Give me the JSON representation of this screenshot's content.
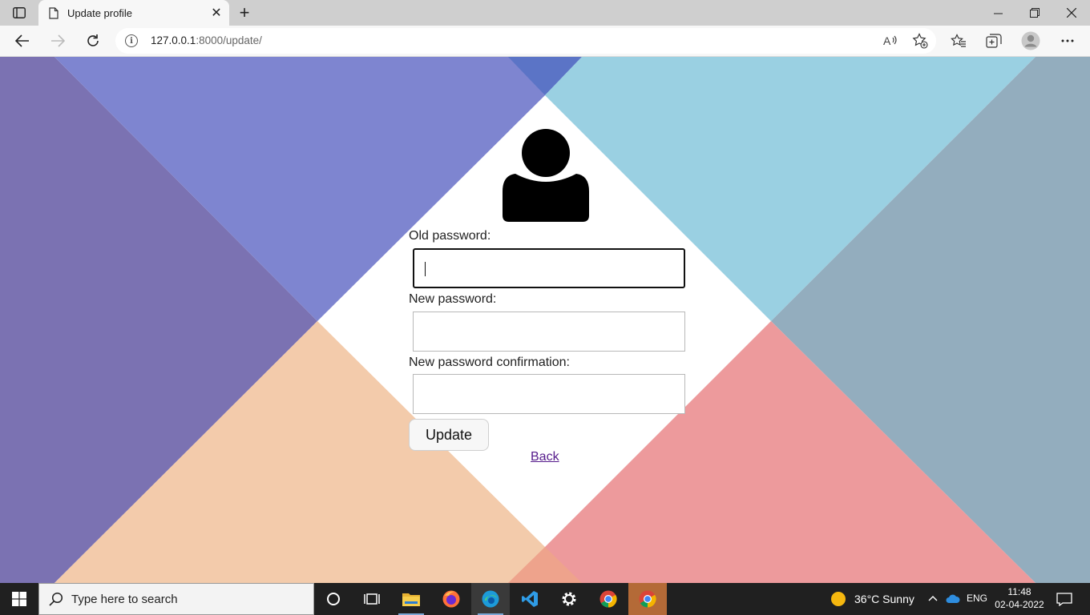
{
  "browser": {
    "tab_title": "Update profile",
    "url_host": "127.0.0.1",
    "url_rest": ":8000/update/"
  },
  "form": {
    "old_password_label": "Old password:",
    "new_password_label": "New password:",
    "confirm_password_label": "New password confirmation:",
    "old_password_value": "",
    "new_password_value": "",
    "confirm_password_value": "",
    "update_button": "Update",
    "back_link": "Back"
  },
  "colors": {
    "left_triangle": "#7b72b2",
    "top_triangle": "#7e85d0",
    "top_right_triangle": "#9ad0e2",
    "right_triangle": "#93adbe",
    "bottom_left_triangle": "#f3cbab",
    "bottom_right_triangle": "#ed9a9c"
  },
  "taskbar": {
    "search_placeholder": "Type here to search",
    "weather": "36°C  Sunny",
    "language": "ENG",
    "time": "11:48",
    "date": "02-04-2022"
  }
}
